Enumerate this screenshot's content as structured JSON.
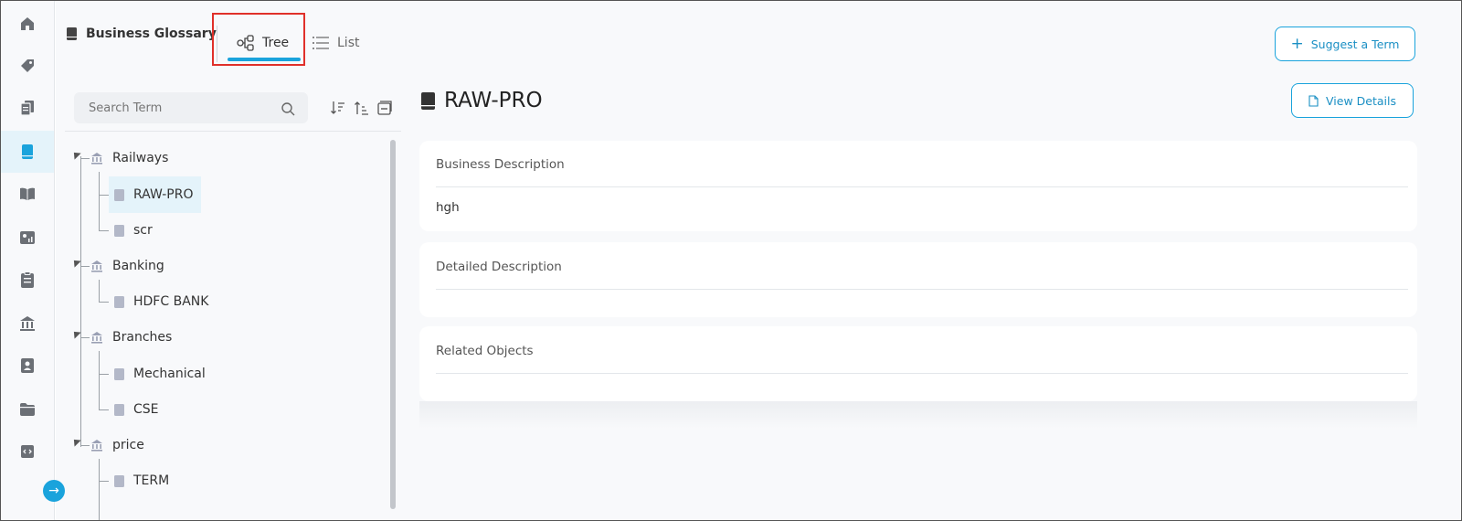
{
  "header": {
    "title": "Business Glossary",
    "tabs": [
      {
        "label": "Tree",
        "active": true
      },
      {
        "label": "List",
        "active": false
      }
    ],
    "suggest_button": "Suggest a Term"
  },
  "sidebar": {
    "items": [
      {
        "icon": "home-icon",
        "active": false
      },
      {
        "icon": "tag-icon",
        "active": false
      },
      {
        "icon": "copy-documents-icon",
        "active": false
      },
      {
        "icon": "glossary-book-icon",
        "active": true
      },
      {
        "icon": "open-book-icon",
        "active": false
      },
      {
        "icon": "dashboard-icon",
        "active": false
      },
      {
        "icon": "clipboard-checklist-icon",
        "active": false
      },
      {
        "icon": "bank-icon",
        "active": false
      },
      {
        "icon": "contact-book-icon",
        "active": false
      },
      {
        "icon": "folder-icon",
        "active": false
      },
      {
        "icon": "code-file-icon",
        "active": false
      }
    ]
  },
  "tree": {
    "search_placeholder": "Search Term",
    "domains": [
      {
        "label": "Railways",
        "terms": [
          "RAW-PRO",
          "scr"
        ]
      },
      {
        "label": "Banking",
        "terms": [
          "HDFC BANK"
        ]
      },
      {
        "label": "Branches",
        "terms": [
          "Mechanical",
          "CSE"
        ]
      },
      {
        "label": "price",
        "terms": [
          "TERM"
        ]
      }
    ],
    "selected_term": "RAW-PRO"
  },
  "detail": {
    "title": "RAW-PRO",
    "view_details_button": "View Details",
    "sections": [
      {
        "label": "Business Description",
        "value": "hgh"
      },
      {
        "label": "Detailed Description",
        "value": ""
      },
      {
        "label": "Related Objects",
        "value": ""
      }
    ]
  },
  "colors": {
    "accent": "#1aa3dc",
    "highlight_box": "#e0302a",
    "nav_icon": "#6b6f75"
  }
}
